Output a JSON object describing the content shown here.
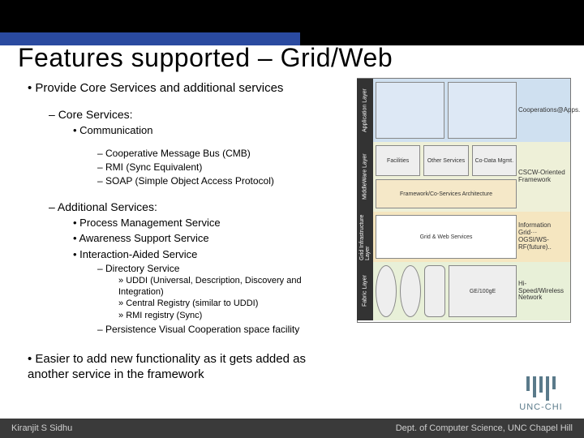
{
  "title": "Features supported – Grid/Web",
  "main": {
    "p1": "Provide Core Services and additional services",
    "core_hdr": "Core Services:",
    "core_comm": "Communication",
    "core_i1": "Cooperative Message Bus (CMB)",
    "core_i2": "RMI (Sync Equivalent)",
    "core_i3": "SOAP (Simple Object Access Protocol)",
    "add_hdr": "Additional Services:",
    "add_i1": "Process Management Service",
    "add_i2": "Awareness Support Service",
    "add_i3": "Interaction-Aided Service",
    "dir_hdr": "Directory Service",
    "dir_i1": "UDDI (Universal, Description, Discovery and Integration)",
    "dir_i2": "Central Registry (similar to UDDI)",
    "dir_i3": "RMI registry (Sync)",
    "pers": "Persistence Visual Cooperation space facility",
    "p2": "Easier to add new functionality as it gets added as another service in the framework"
  },
  "diagram": {
    "l1": {
      "label": "Application Layer",
      "side": "Cooperations@Apps.",
      "boxes": [
        "",
        "",
        ""
      ]
    },
    "l2": {
      "label": "MiddleWare Layer",
      "side": "CSCW-Oriented Framework",
      "row1": [
        "Facilities",
        "Other Services",
        "Co-Data Mgmt."
      ],
      "row2": "Framework/Co-Services Architecture"
    },
    "l3": {
      "label": "Grid Infrastructure Layer",
      "side": "Information Grid··· OGSI/WS-RF(future)..",
      "box": "Grid & Web Services"
    },
    "l4": {
      "label": "Fabric Layer",
      "side": "Hi-Speed/Wireless Network",
      "boxes": [
        "",
        "",
        "",
        "GE/100gE"
      ]
    }
  },
  "footer": {
    "left": "Kiranjit S Sidhu",
    "right": "Dept. of Computer Science, UNC Chapel Hill"
  },
  "logo": "UNC-CHI"
}
